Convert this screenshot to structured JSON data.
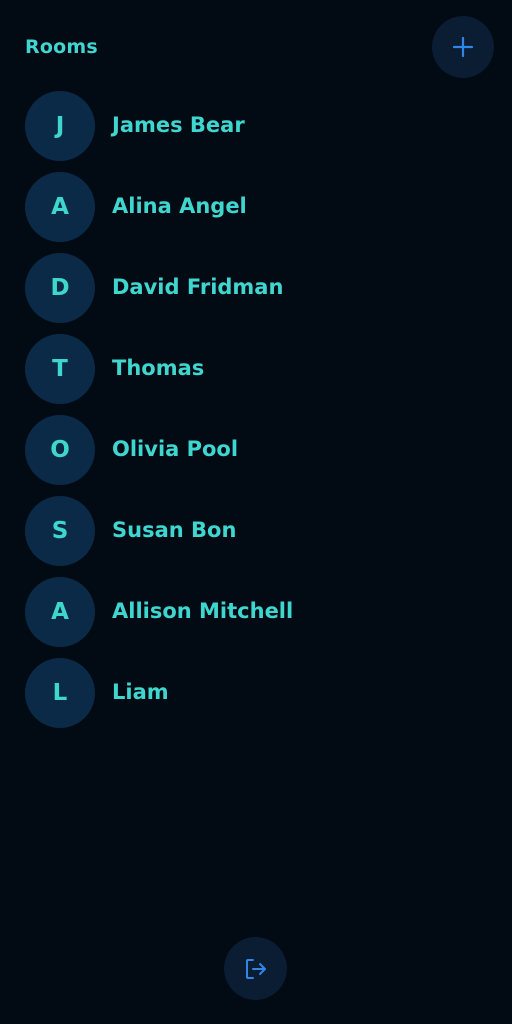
{
  "header": {
    "title": "Rooms",
    "add_icon": "plus-icon"
  },
  "rooms": [
    {
      "initial": "J",
      "name": "James Bear"
    },
    {
      "initial": "A",
      "name": "Alina Angel"
    },
    {
      "initial": "D",
      "name": "David Fridman"
    },
    {
      "initial": "T",
      "name": "Thomas"
    },
    {
      "initial": "O",
      "name": "Olivia Pool"
    },
    {
      "initial": "S",
      "name": "Susan Bon"
    },
    {
      "initial": "A",
      "name": "Allison Mitchell"
    },
    {
      "initial": "L",
      "name": "Liam"
    }
  ],
  "footer": {
    "logout_icon": "logout-icon"
  },
  "colors": {
    "background": "#020a14",
    "accent_text": "#3fd6d0",
    "avatar_bg": "#0b2a47",
    "button_bg": "#0a1d33",
    "icon_blue": "#2f86e6"
  }
}
